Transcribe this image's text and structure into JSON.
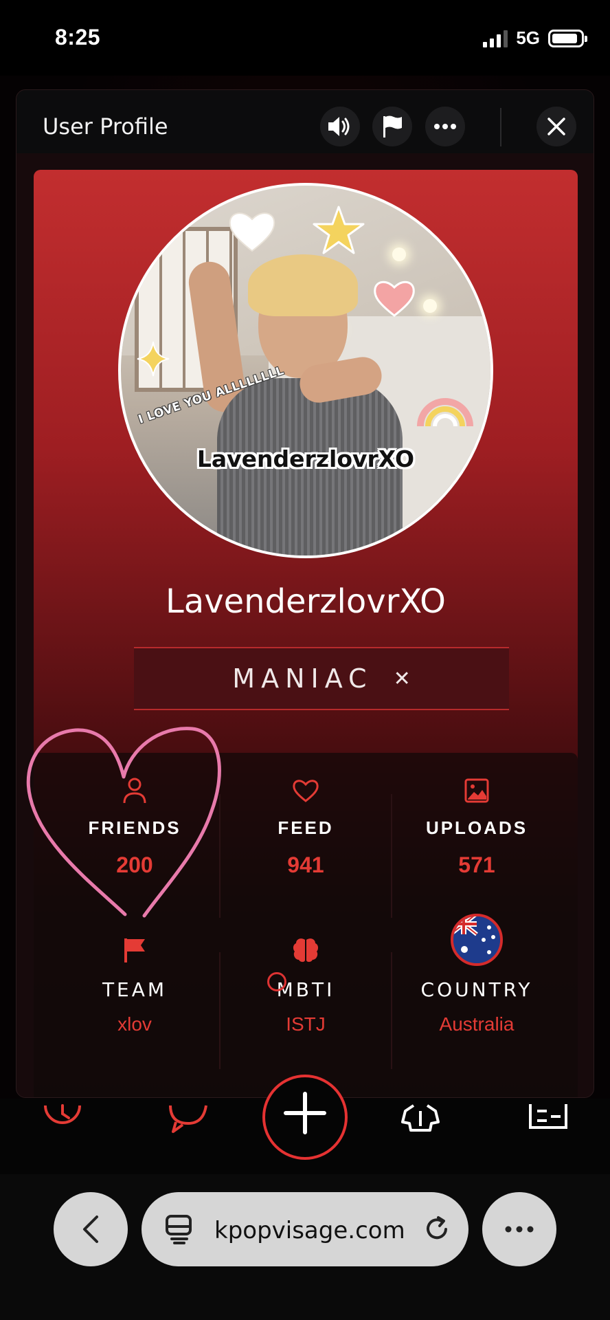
{
  "status_bar": {
    "time": "8:25",
    "network": "5G",
    "battery_level": 0.9
  },
  "modal": {
    "title": "User Profile",
    "actions": [
      {
        "name": "sound",
        "icon": "speaker-icon"
      },
      {
        "name": "report",
        "icon": "flag-icon"
      },
      {
        "name": "more",
        "icon": "ellipsis-icon"
      },
      {
        "name": "close",
        "icon": "close-icon"
      }
    ]
  },
  "profile": {
    "avatar_caption": "I LOVE YOU ALLLLLLLL",
    "avatar_name": "LavenderzlovrXO",
    "username": "LavenderzlovrXO",
    "badge": {
      "label": "MANIAC",
      "icon": "close-icon"
    }
  },
  "stats": {
    "friends": {
      "label": "FRIENDS",
      "value": "200",
      "icon": "person-icon"
    },
    "feed": {
      "label": "FEED",
      "value": "941",
      "icon": "heart-icon"
    },
    "uploads": {
      "label": "UPLOADS",
      "value": "571",
      "icon": "image-icon"
    },
    "team": {
      "label": "TEAM",
      "value": "xlov",
      "icon": "flag-icon"
    },
    "mbti": {
      "label": "MBTI",
      "value": "ISTJ",
      "icon": "brain-icon"
    },
    "country": {
      "label": "COUNTRY",
      "value": "Australia",
      "icon": "australia-flag-icon"
    }
  },
  "tabbar": {
    "items": [
      "clock-icon",
      "chat-icon",
      "plus-icon",
      "shirt-icon",
      "id-card-icon"
    ]
  },
  "browser": {
    "url": "kpopvisage.com",
    "back_icon": "chevron-left-icon",
    "tabs_icon": "page-icon",
    "reload_icon": "reload-icon",
    "more_icon": "ellipsis-icon"
  },
  "colors": {
    "accent_red": "#e43b35",
    "card_top": "#c22e2f",
    "doodle_pink": "#e87aab"
  }
}
